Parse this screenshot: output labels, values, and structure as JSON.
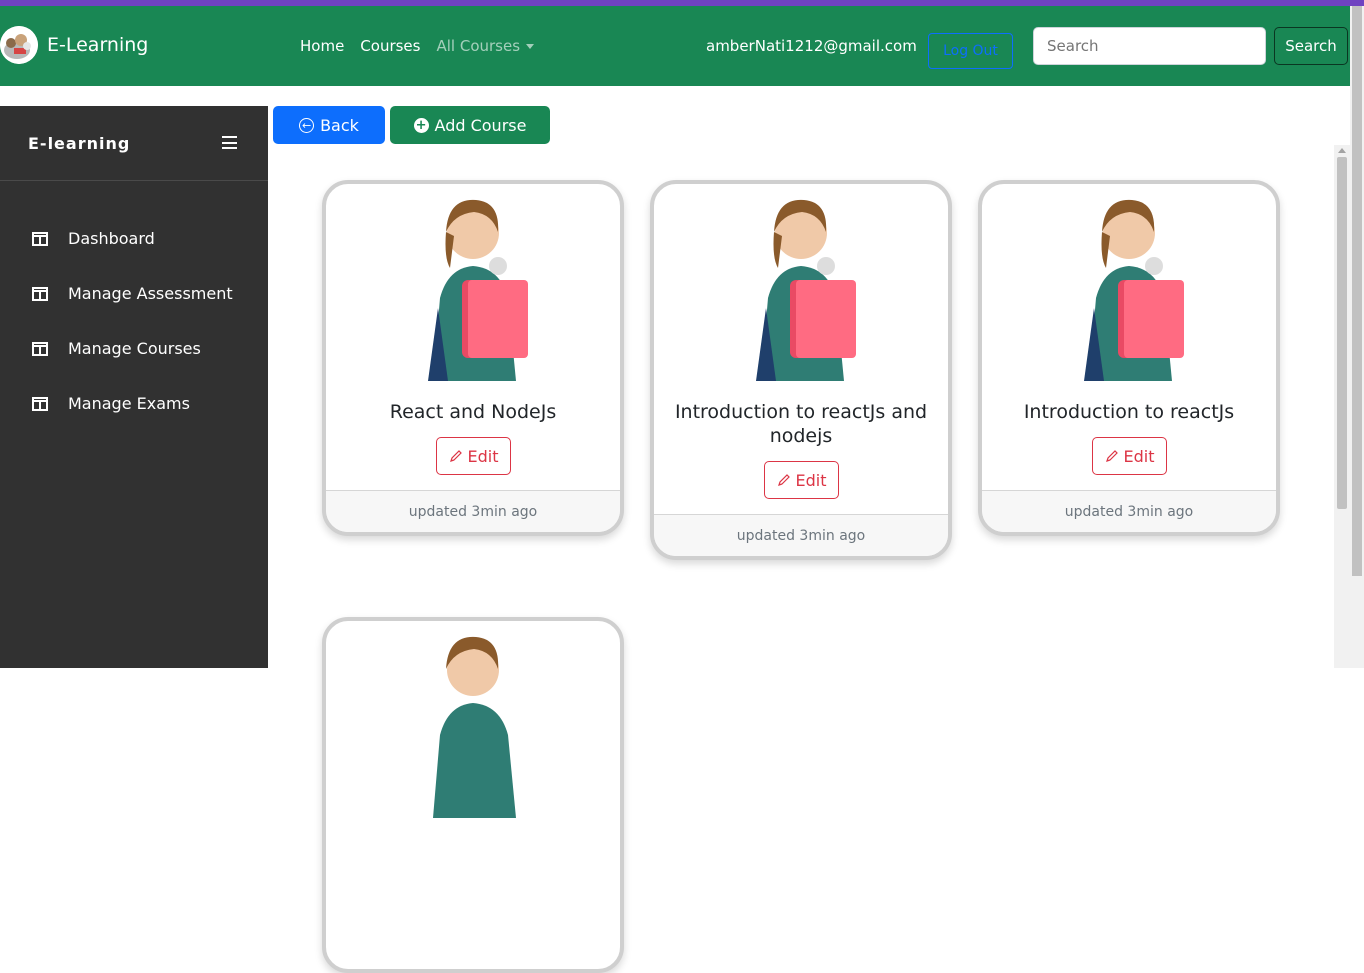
{
  "navbar": {
    "brand": "E-Learning",
    "links": [
      {
        "label": "Home"
      },
      {
        "label": "Courses"
      },
      {
        "label": "All Courses"
      }
    ],
    "user_email": "amberNati1212@gmail.com",
    "logout_label": "Log Out",
    "search_placeholder": "Search",
    "search_button": "Search"
  },
  "sidebar": {
    "title": "E-learning",
    "items": [
      {
        "label": "Dashboard",
        "icon": "layout-icon"
      },
      {
        "label": "Manage Assessment",
        "icon": "layout-icon"
      },
      {
        "label": "Manage Courses",
        "icon": "layout-icon"
      },
      {
        "label": "Manage Exams",
        "icon": "layout-icon"
      }
    ]
  },
  "actions": {
    "back_label": "Back",
    "add_label": "Add Course"
  },
  "courses": [
    {
      "title": "React and NodeJs",
      "edit_label": "Edit",
      "updated": "updated 3min ago"
    },
    {
      "title": "Introduction to reactJs and nodejs",
      "edit_label": "Edit",
      "updated": "updated 3min ago"
    },
    {
      "title": "Introduction to reactJs",
      "edit_label": "Edit",
      "updated": "updated 3min ago"
    }
  ],
  "colors": {
    "navbar": "#198754",
    "sidebar": "#313131",
    "primary": "#0d6efd",
    "danger": "#dc3545"
  }
}
